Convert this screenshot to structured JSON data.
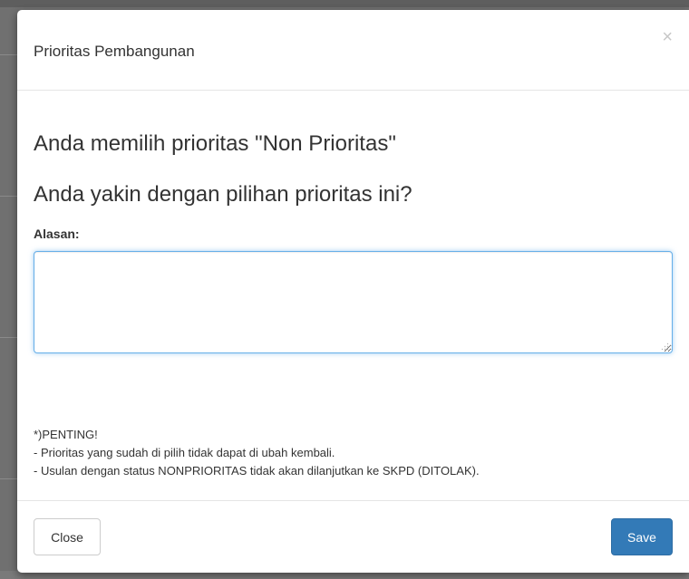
{
  "modal": {
    "title": "Prioritas Pembangunan",
    "close_symbol": "×"
  },
  "body": {
    "message_primary": "Anda memilih prioritas \"Non Prioritas\"",
    "message_confirm": "Anda yakin dengan pilihan prioritas ini?",
    "reason_label": "Alasan:",
    "reason_value": "",
    "notes": [
      "*)PENTING!",
      "- Prioritas yang sudah di pilih tidak dapat di ubah kembali.",
      "- Usulan dengan status NONPRIORITAS tidak akan dilanjutkan ke SKPD (DITOLAK)."
    ]
  },
  "footer": {
    "close_label": "Close",
    "save_label": "Save"
  },
  "colors": {
    "primary": "#337ab7",
    "focus_border": "#66afe9",
    "backdrop": "#707070"
  }
}
